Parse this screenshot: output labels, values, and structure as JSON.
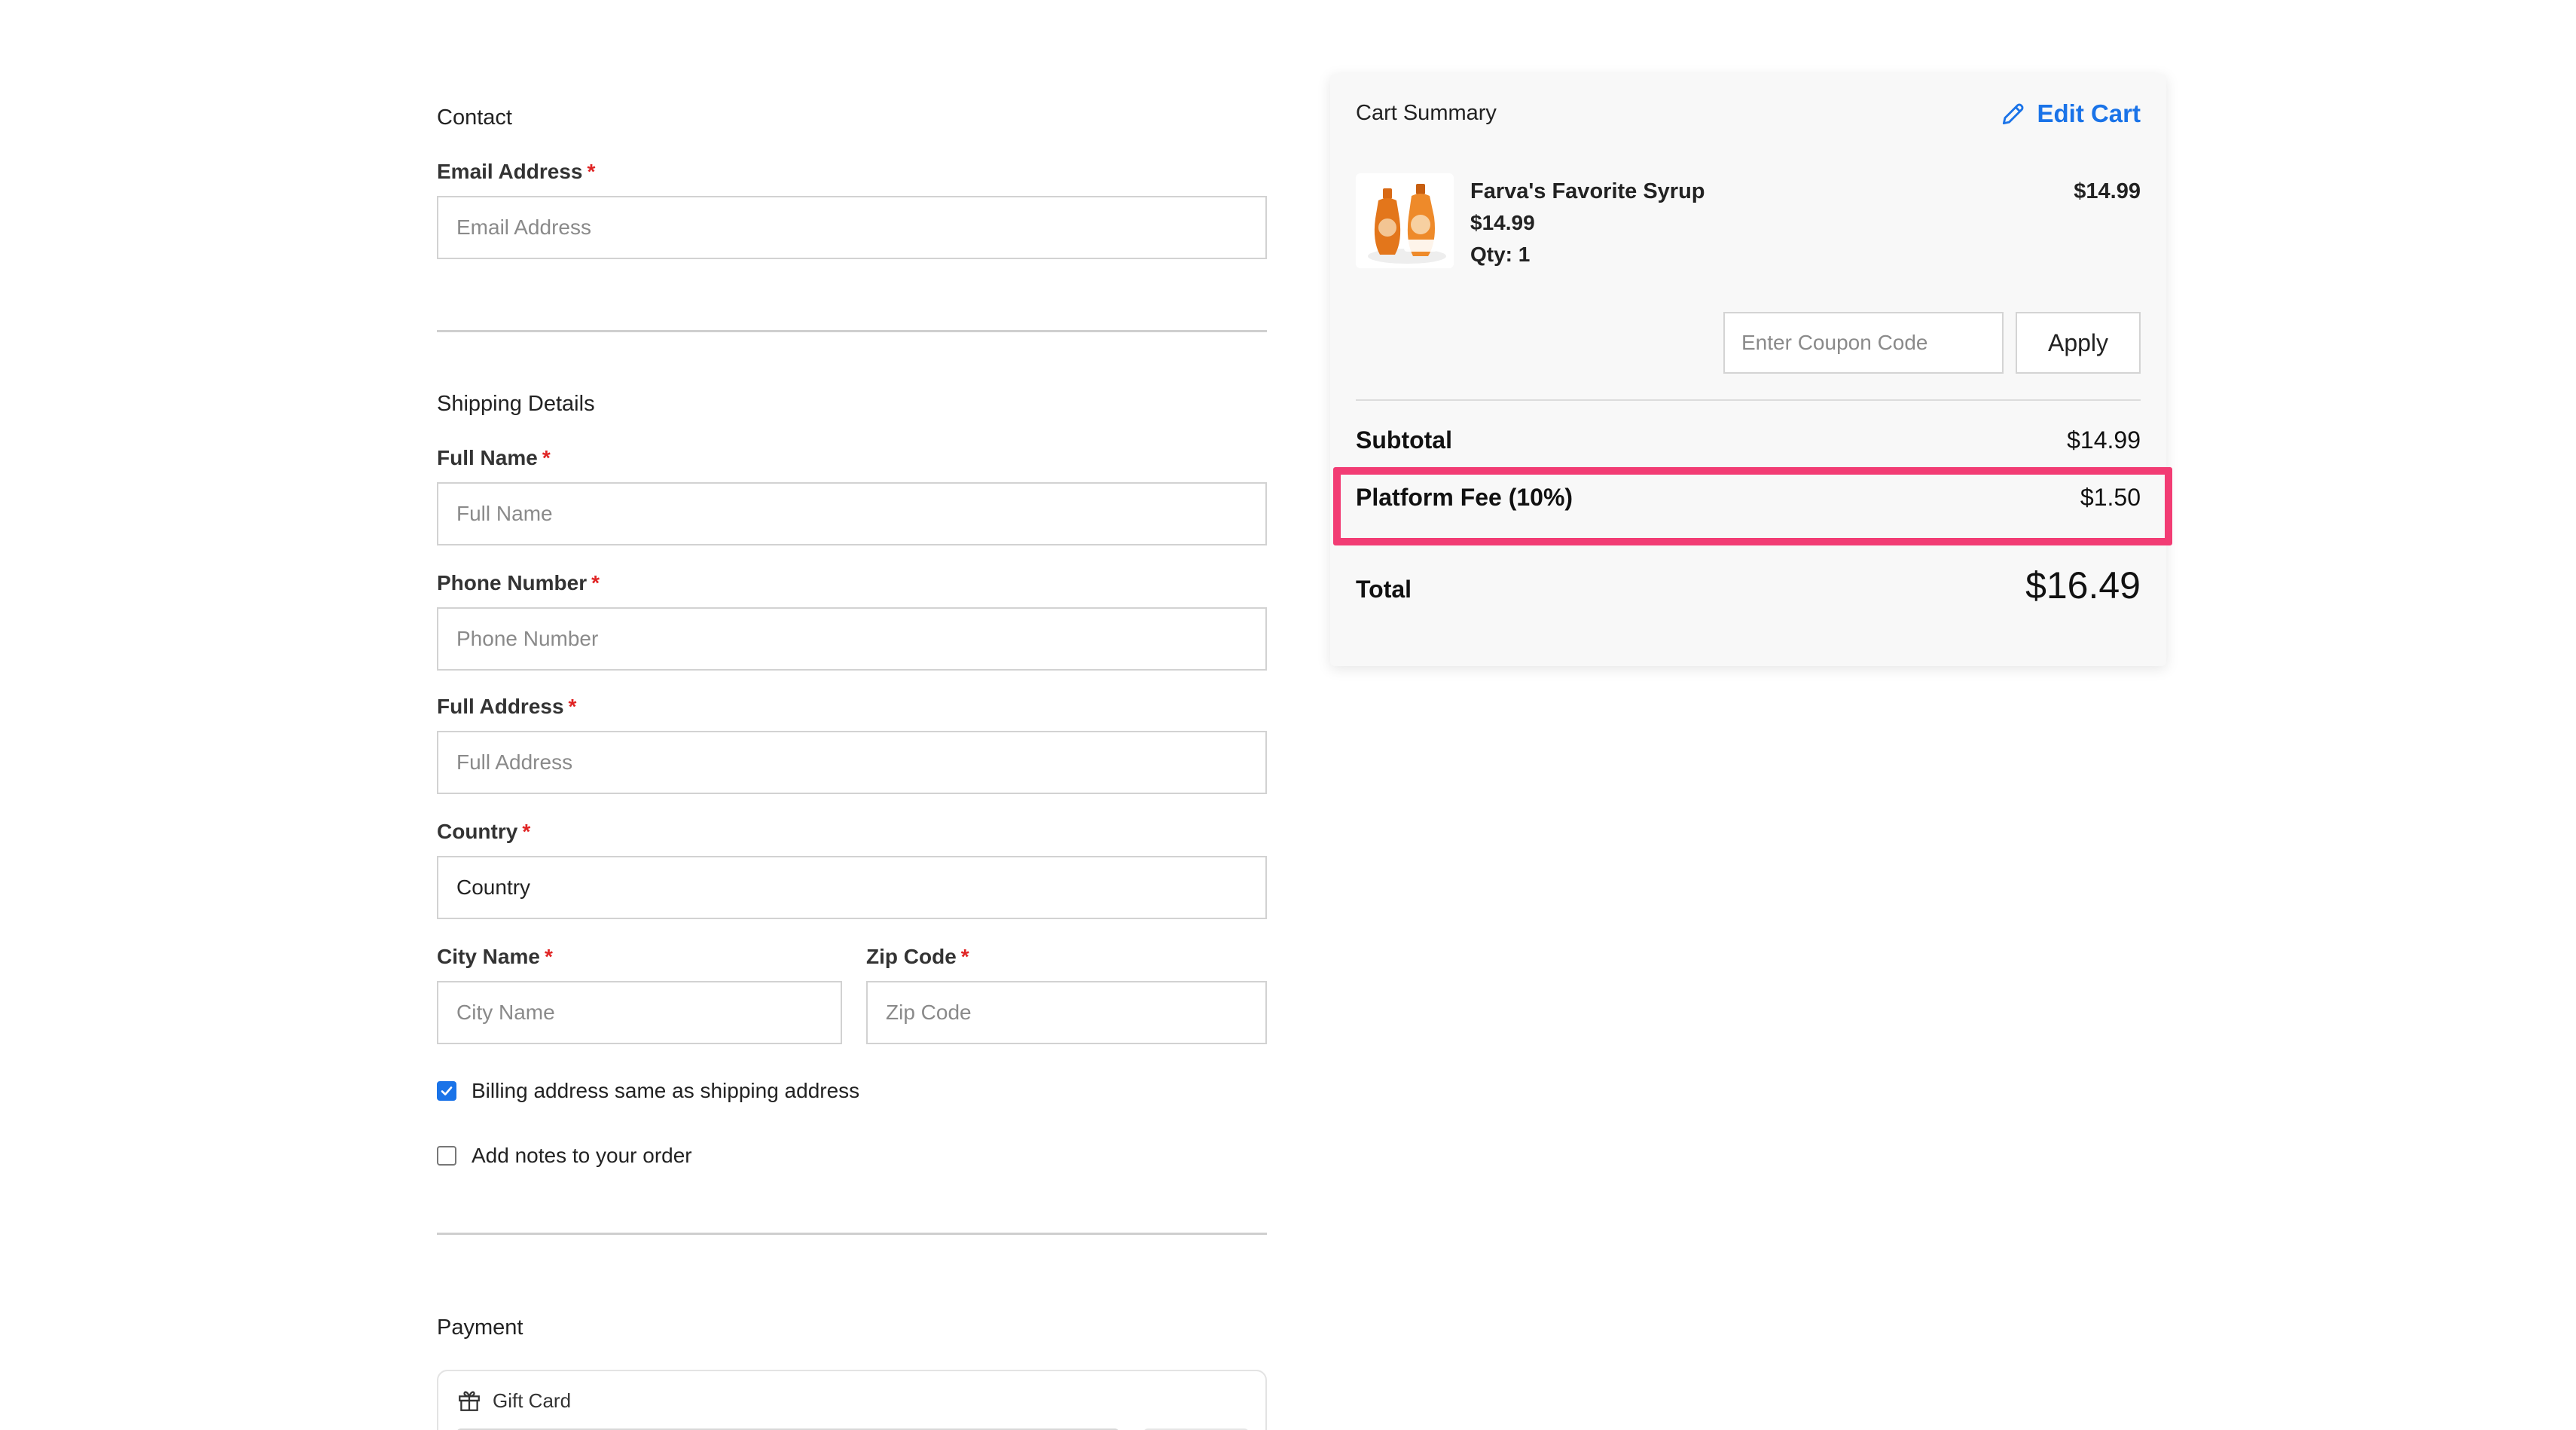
{
  "contact": {
    "title": "Contact",
    "email_label": "Email Address",
    "email_placeholder": "Email Address",
    "required_mark": "*"
  },
  "shipping": {
    "title": "Shipping Details",
    "full_name_label": "Full Name",
    "full_name_placeholder": "Full Name",
    "phone_label": "Phone Number",
    "phone_placeholder": "Phone Number",
    "address_label": "Full Address",
    "address_placeholder": "Full Address",
    "country_label": "Country",
    "country_value": "Country",
    "city_label": "City Name",
    "city_placeholder": "City Name",
    "zip_label": "Zip Code",
    "zip_placeholder": "Zip Code",
    "billing_same_label": "Billing address same as shipping address",
    "billing_same_checked": true,
    "add_notes_label": "Add notes to your order",
    "add_notes_checked": false
  },
  "payment": {
    "title": "Payment",
    "gift_card_label": "Gift Card"
  },
  "cart": {
    "title": "Cart Summary",
    "edit_label": "Edit Cart",
    "item": {
      "name": "Farva's Favorite Syrup",
      "price": "$14.99",
      "qty": "Qty: 1",
      "line_total": "$14.99"
    },
    "coupon_placeholder": "Enter Coupon Code",
    "apply_label": "Apply",
    "subtotal_label": "Subtotal",
    "subtotal_value": "$14.99",
    "fee_label": "Platform Fee (10%)",
    "fee_value": "$1.50",
    "total_label": "Total",
    "total_value": "$16.49"
  },
  "colors": {
    "accent": "#1a73e8",
    "required": "#e02424",
    "highlight": "#f23c74"
  }
}
